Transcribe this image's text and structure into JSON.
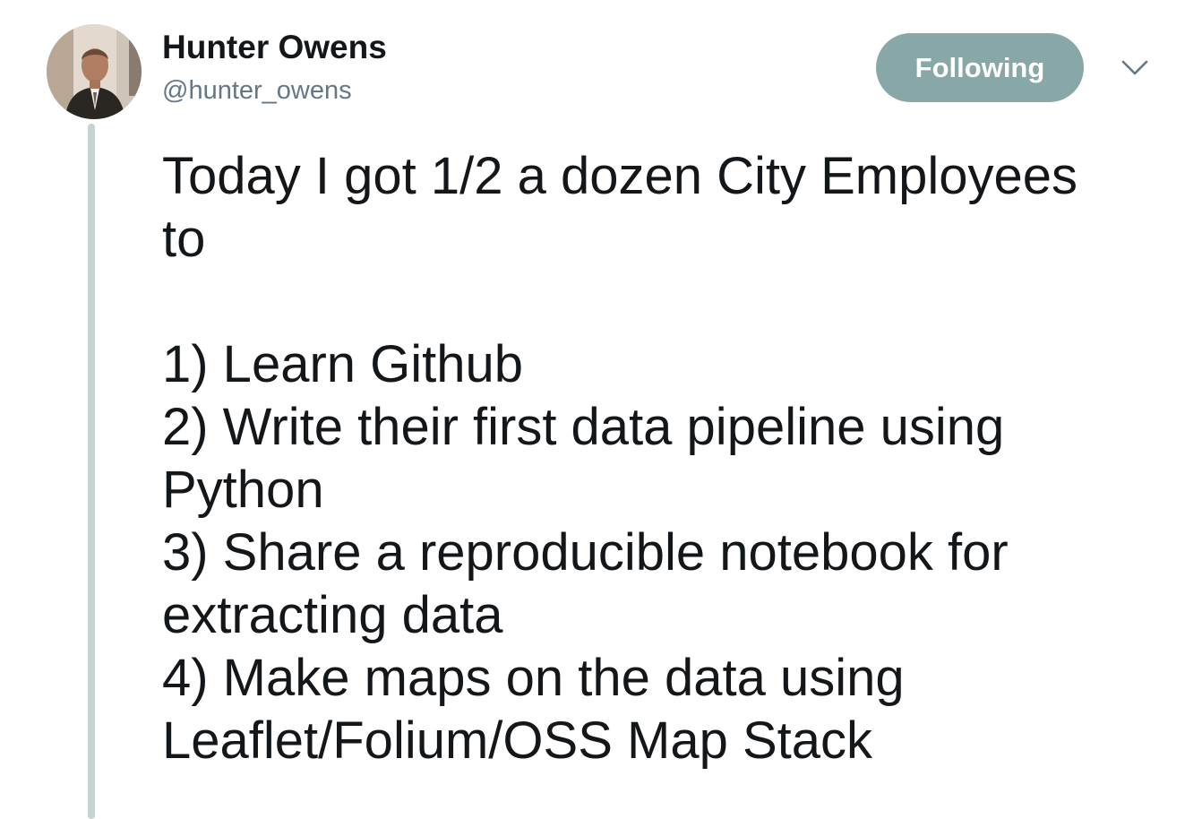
{
  "author": {
    "display_name": "Hunter Owens",
    "handle": "@hunter_owens"
  },
  "follow_button": {
    "label": "Following",
    "color": "#87a8a6"
  },
  "more_menu": {
    "icon": "chevron-down-icon"
  },
  "tweet": {
    "lines": [
      "Today I got 1/2 a dozen City Employees",
      "to",
      "",
      "1) Learn Github",
      "2) Write their first data pipeline using",
      "Python",
      "3) Share a reproducible notebook for",
      "extracting data",
      "4) Make maps on the data using",
      "Leaflet/Folium/OSS Map Stack"
    ]
  },
  "colors": {
    "text": "#14171a",
    "secondary_text": "#657786",
    "thread_line": "#c4d4d3"
  }
}
